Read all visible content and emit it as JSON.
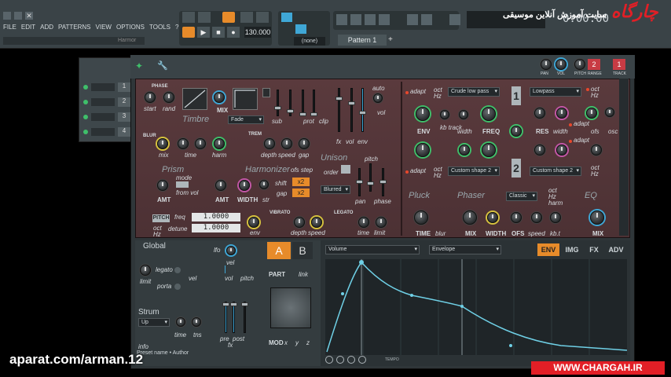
{
  "menu": {
    "items": [
      "FILE",
      "EDIT",
      "ADD",
      "PATTERNS",
      "VIEW",
      "OPTIONS",
      "TOOLS",
      "?"
    ]
  },
  "transport": {
    "tempo": "130.000",
    "time": "0:00:00",
    "pattern": "Pattern 1",
    "none": "(none)"
  },
  "overlay": {
    "site_fa": "سایت آموزش آنلاین موسیقی",
    "brand_fa": "چارگاه",
    "url": "WWW.CHARGAH.IR",
    "watermark": "aparat.com/arman.12"
  },
  "channel_rack": {
    "title": "Harmor",
    "rows": [
      "1",
      "2",
      "3",
      "4"
    ]
  },
  "header_knobs": {
    "pan": "PAN",
    "vol": "VOL",
    "pitch": "PITCH",
    "range": "RANGE",
    "track": "TRACK",
    "range_val": "2",
    "track_val": "1"
  },
  "timbre": {
    "phase": "PHASE",
    "start": "start",
    "rand": "rand",
    "mix": "MIX",
    "title": "Timbre",
    "fade": "Fade",
    "sub": "sub",
    "prot": "prot",
    "clip": "clip",
    "fx": "fx",
    "vol": "vol",
    "env": "env",
    "auto": "auto",
    "volb": "vol"
  },
  "blur": {
    "title": "BLUR",
    "mix": "mix",
    "time": "time",
    "harm": "harm",
    "trem": "TREM",
    "depth": "depth",
    "speed": "speed",
    "gap": "gap"
  },
  "prism": {
    "title": "Prism",
    "amt": "AMT",
    "mode": "mode",
    "from_vol": "from vol"
  },
  "harmonizer": {
    "title": "Harmonizer",
    "ofs_step": "ofs step",
    "amt": "AMT",
    "width": "WIDTH",
    "str": "str",
    "shift": "shift",
    "gap": "gap",
    "x2a": "x2",
    "x2b": "x2",
    "blurred": "Blurred"
  },
  "unison": {
    "title": "Unison",
    "order": "order",
    "pitch": "pitch",
    "pan": "pan",
    "phase": "phase"
  },
  "pitch_row": {
    "pitch": "PITCH",
    "oct": "oct",
    "hz": "Hz",
    "freq": "freq",
    "detune": "detune",
    "freq_val": "1.0000",
    "detune_val": "1.0000",
    "env": "env"
  },
  "vibrato": {
    "title": "VIBRATO",
    "depth": "depth",
    "speed": "speed"
  },
  "legato": {
    "title": "LEGATO",
    "time": "time",
    "limit": "limit"
  },
  "filter1": {
    "adapt": "adapt",
    "oct": "oct",
    "hz": "Hz",
    "type": "Crude low pass",
    "env": "ENV",
    "kb_track": "kb track",
    "width": "width",
    "freq": "FREQ",
    "num": "1"
  },
  "filter2": {
    "adapt": "adapt",
    "oct": "oct",
    "hz": "Hz",
    "type": "Custom shape 2",
    "num": "2"
  },
  "right1": {
    "type": "Lowpass",
    "oct": "oct",
    "hz": "Hz",
    "res": "RES",
    "width": "width",
    "ofs": "ofs",
    "osc": "osc",
    "adapt": "adapt"
  },
  "right2": {
    "type": "Custom shape 2",
    "adapt": "adapt",
    "oct": "oct",
    "hz": "Hz"
  },
  "pluck": {
    "title": "Pluck",
    "time": "TIME",
    "blur": "blur"
  },
  "phaser": {
    "title": "Phaser",
    "mix": "MIX",
    "width": "WIDTH",
    "ofs": "OFS",
    "speed": "speed",
    "kbt": "kb.t",
    "type": "Classic",
    "oct": "oct",
    "hz": "Hz",
    "harm": "harm"
  },
  "eq": {
    "title": "EQ",
    "mix": "MIX"
  },
  "global": {
    "title": "Global",
    "limit": "limit",
    "legato": "legato",
    "porta": "porta",
    "vel": "vel",
    "lfo": "lfo",
    "velb": "vel",
    "vol": "vol",
    "pitch": "pitch",
    "part": "PART",
    "link": "link",
    "a": "A",
    "b": "B",
    "pre": "pre",
    "post": "post",
    "fx": "fx",
    "mod": "MOD",
    "x": "x",
    "y": "y",
    "z": "z"
  },
  "strum": {
    "title": "Strum",
    "dir": "Up",
    "time": "time",
    "tns": "tns",
    "info": "info",
    "preset": "Preset name • Author"
  },
  "envelope": {
    "target": "Volume",
    "kind": "Envelope",
    "tabs": [
      "ENV",
      "IMG",
      "FX",
      "ADV"
    ],
    "tempo": "TEMPO"
  }
}
